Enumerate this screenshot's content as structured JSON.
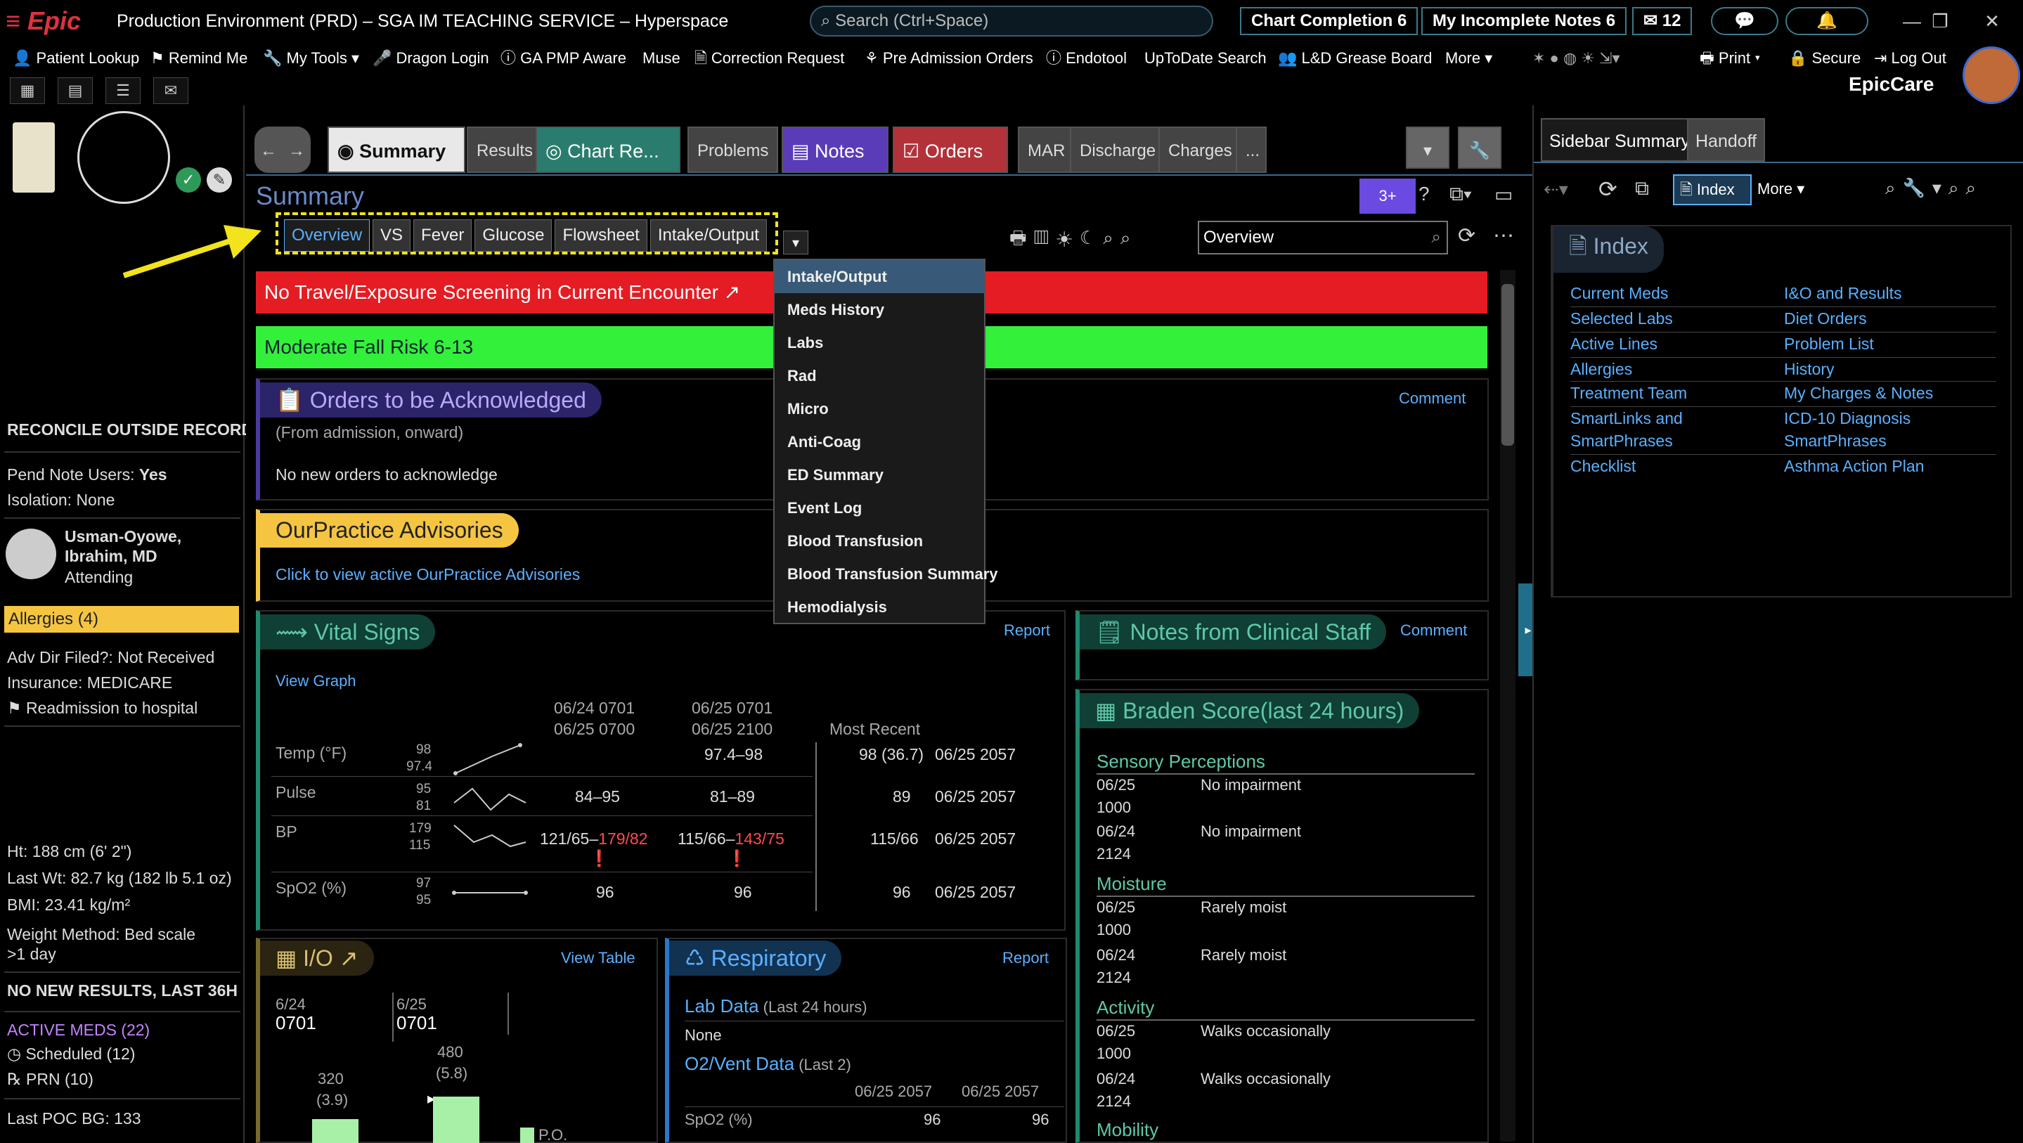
{
  "titlebar": {
    "logo": "≡ Epic",
    "title": "Production Environment (PRD) – SGA IM TEACHING SERVICE – Hyperspace",
    "search_placeholder": "Search (Ctrl+Space)",
    "chart_completion": "Chart Completion 6",
    "incomplete_notes": "My Incomplete Notes 6",
    "inbox_count": "12",
    "minimize": "—",
    "restore": "❐",
    "close": "✕"
  },
  "toolbar": {
    "items": [
      "Patient Lookup",
      "Remind Me",
      "My Tools ▾",
      "Dragon Login",
      "GA PMP Aware",
      "Muse",
      "Correction Request",
      "Pre Admission Orders",
      "Endotool",
      "UpToDate Search",
      "L&D Grease Board",
      "More ▾"
    ],
    "print": "Print",
    "secure": "Secure",
    "logout": "Log Out",
    "product": "EpicCare"
  },
  "left_sidebar": {
    "reconcile": "RECONCILE OUTSIDE RECORDS",
    "pend_note_label": "Pend Note Users:",
    "pend_note_value": "Yes",
    "isolation": "Isolation: None",
    "attending_name_1": "Usman-Oyowe,",
    "attending_name_2": "Ibrahim, MD",
    "attending_role": "Attending",
    "allergies": "Allergies (4)",
    "adv_dir": "Adv Dir Filed?: Not Received",
    "insurance": "Insurance: MEDICARE",
    "readmission": "Readmission to hospital",
    "height": "Ht:  188 cm (6' 2\")",
    "last_wt": "Last Wt:  82.7 kg (182 lb 5.1 oz)",
    "bmi": "BMI:  23.41 kg/m²",
    "weight_method": "Weight Method:  Bed scale",
    "weight_method_2": " >1 day",
    "no_new_results": "NO NEW RESULTS, LAST 36H",
    "active_meds": "ACTIVE MEDS (22)",
    "scheduled": "Scheduled (12)",
    "prn": "PRN (10)",
    "last_poc": "Last POC BG: 133"
  },
  "tabs": {
    "summary": "Summary",
    "results": "Results",
    "chart_review": "Chart Re...",
    "problems": "Problems",
    "notes": "Notes",
    "orders": "Orders",
    "mar": "MAR",
    "discharge": "Discharge",
    "charges": "Charges",
    "more": "..."
  },
  "summary": {
    "title": "Summary",
    "report_tabs": [
      "Overview",
      "VS",
      "Fever",
      "Glucose",
      "Flowsheet",
      "Intake/Output"
    ],
    "report_select": "Overview",
    "badge": "3+"
  },
  "dropdown": {
    "items": [
      "Intake/Output",
      "Meds History",
      "Labs",
      "Rad",
      "Micro",
      "Anti-Coag",
      "ED Summary",
      "Event Log",
      "Blood Transfusion",
      "Blood Transfusion Summary",
      "Hemodialysis"
    ]
  },
  "banners": {
    "travel": "No Travel/Exposure Screening in Current Encounter ↗",
    "fall": "Moderate Fall Risk 6-13"
  },
  "orders_ack": {
    "title": "Orders to be Acknowledged",
    "comment": "Comment",
    "subtitle": "(From admission, onward)",
    "body": "No new orders to acknowledge"
  },
  "advisories": {
    "title": "OurPractice Advisories",
    "link": "Click to view active OurPractice Advisories"
  },
  "vitals": {
    "title": "Vital Signs",
    "report": "Report",
    "view_graph": "View Graph",
    "col1_line1": "06/24 0701",
    "col1_line2": "06/25 0700",
    "col2_line1": "06/25 0701",
    "col2_line2": "06/25 2100",
    "most_recent": "Most Recent",
    "rows": [
      {
        "label": "Temp (°F)",
        "hi": "98",
        "lo": "97.4",
        "c1": "",
        "c2": "97.4–98",
        "recent": "98 (36.7)",
        "date": "06/25 2057"
      },
      {
        "label": "Pulse",
        "hi": "95",
        "lo": "81",
        "c1": "84–95",
        "c2": "81–89",
        "recent": "89",
        "date": "06/25 2057"
      },
      {
        "label": "BP",
        "hi": "179",
        "lo": "115",
        "c1_normal": "121/65–",
        "c1_red": "179/82",
        "c2_normal": "115/66–",
        "c2_red": "143/75",
        "recent": "115/66",
        "date": "06/25 2057"
      },
      {
        "label": "SpO2 (%)",
        "hi": "97",
        "lo": "95",
        "c1": "96",
        "c2": "96",
        "recent": "96",
        "date": "06/25 2057"
      }
    ]
  },
  "io": {
    "title": "I/O ↗",
    "view_table": "View Table",
    "d1": "6/24",
    "t1": "0701",
    "d2": "6/25",
    "t2": "0701",
    "v1": "320",
    "v1b": "(3.9)",
    "v2": "480",
    "v2b": "(5.8)",
    "po": "P.O."
  },
  "respiratory": {
    "title": "Respiratory",
    "report": "Report",
    "lab_data": "Lab Data",
    "lab_data_sub": "(Last 24 hours)",
    "none": "None",
    "o2": "O2/Vent Data",
    "o2_sub": "(Last 2)",
    "d1": "06/25 2057",
    "d2": "06/25 2057",
    "spo2": "SpO2 (%)",
    "v1": "96",
    "v2": "96"
  },
  "notes_staff": {
    "title": "Notes from Clinical Staff",
    "comment": "Comment"
  },
  "braden": {
    "title": "Braden Score(last 24 hours)",
    "sections": [
      {
        "name": "Sensory Perceptions",
        "rows": [
          {
            "d": "06/25",
            "t": "1000",
            "v": "No impairment"
          },
          {
            "d": "06/24",
            "t": "2124",
            "v": "No impairment"
          }
        ]
      },
      {
        "name": "Moisture",
        "rows": [
          {
            "d": "06/25",
            "t": "1000",
            "v": "Rarely moist"
          },
          {
            "d": "06/24",
            "t": "2124",
            "v": "Rarely moist"
          }
        ]
      },
      {
        "name": "Activity",
        "rows": [
          {
            "d": "06/25",
            "t": "1000",
            "v": "Walks occasionally"
          },
          {
            "d": "06/24",
            "t": "2124",
            "v": "Walks occasionally"
          }
        ]
      },
      {
        "name": "Mobility",
        "rows": []
      }
    ]
  },
  "right_sidebar": {
    "tab_summary": "Sidebar Summary",
    "tab_handoff": "Handoff",
    "index_btn": "Index",
    "more": "More ▾",
    "index_title": "Index",
    "left_links": [
      "Current Meds",
      "Selected Labs",
      "Active Lines",
      "Allergies",
      "Treatment Team",
      "SmartLinks and",
      "SmartPhrases",
      "Checklist"
    ],
    "right_links": [
      "I&O and Results",
      "Diet Orders",
      "Problem List",
      "History",
      "My Charges & Notes",
      "ICD-10 Diagnosis",
      "SmartPhrases",
      "Asthma Action Plan"
    ]
  },
  "colors": {
    "travel_banner": "#e51c23",
    "fall_banner": "#33f03a",
    "advisory": "#f5c542",
    "accent": "#5ab0ff",
    "annotation": "#f2e31c"
  }
}
